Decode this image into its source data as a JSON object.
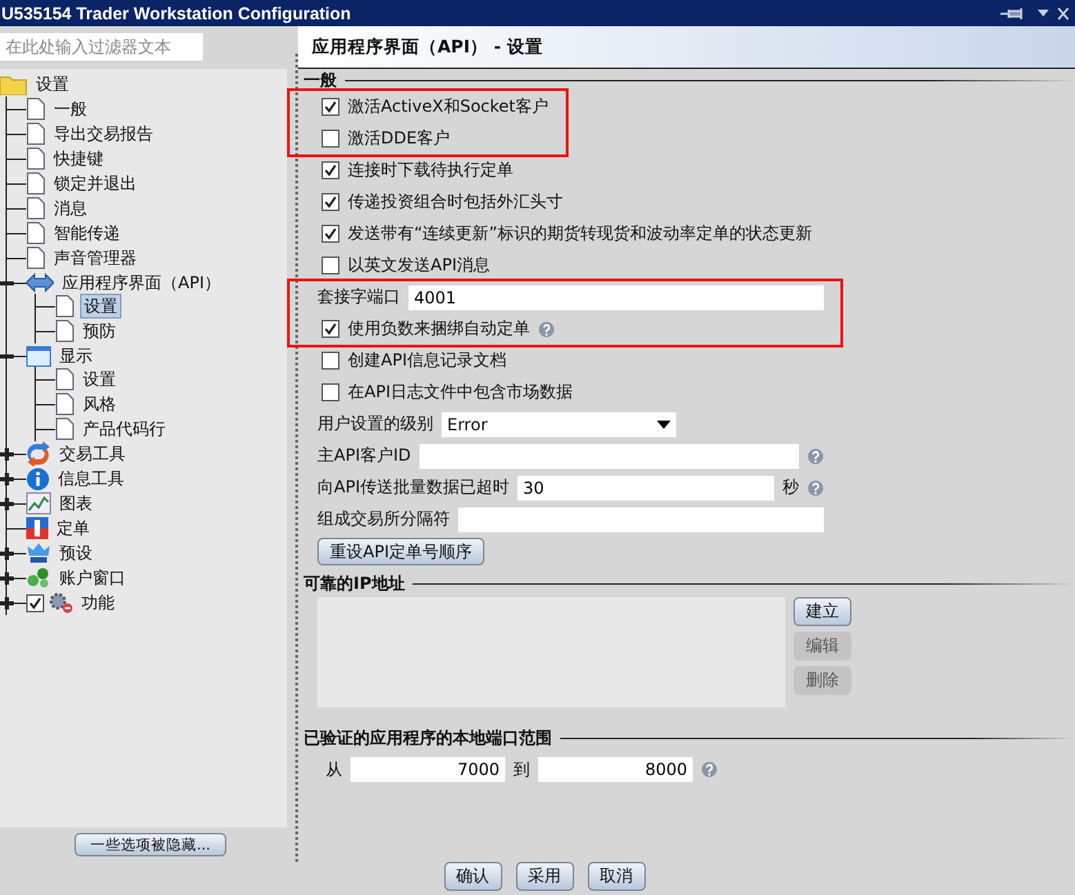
{
  "window": {
    "title": "U535154 Trader Workstation Configuration"
  },
  "filter": {
    "placeholder": "在此处输入过滤器文本"
  },
  "tree": [
    {
      "label": "设置",
      "kind": "folder",
      "selected": false,
      "children": [
        {
          "label": "一般",
          "kind": "page",
          "selected": false
        },
        {
          "label": "导出交易报告",
          "kind": "page",
          "selected": false
        },
        {
          "label": "快捷键",
          "kind": "page",
          "selected": false
        },
        {
          "label": "锁定并退出",
          "kind": "page",
          "selected": false
        },
        {
          "label": "消息",
          "kind": "page",
          "selected": false
        },
        {
          "label": "智能传递",
          "kind": "page",
          "selected": false
        },
        {
          "label": "声音管理器",
          "kind": "page",
          "selected": false
        },
        {
          "label": "应用程序界面（API）",
          "kind": "arrows",
          "expanded": true,
          "selected": false,
          "children": [
            {
              "label": "设置",
              "kind": "page",
              "selected": true
            },
            {
              "label": "预防",
              "kind": "page",
              "selected": false
            }
          ]
        },
        {
          "label": "显示",
          "kind": "display",
          "expanded": true,
          "selected": false,
          "children": [
            {
              "label": "设置",
              "kind": "page",
              "selected": false
            },
            {
              "label": "风格",
              "kind": "page",
              "selected": false
            },
            {
              "label": "产品代码行",
              "kind": "page",
              "selected": false
            }
          ]
        },
        {
          "label": "交易工具",
          "kind": "tools",
          "expanded": false,
          "selected": false
        },
        {
          "label": "信息工具",
          "kind": "info",
          "expanded": false,
          "selected": false
        },
        {
          "label": "图表",
          "kind": "chart",
          "expanded": false,
          "selected": false
        },
        {
          "label": "定单",
          "kind": "order",
          "selected": false
        },
        {
          "label": "预设",
          "kind": "crown",
          "expanded": false,
          "selected": false
        },
        {
          "label": "账户窗口",
          "kind": "account",
          "expanded": false,
          "selected": false
        },
        {
          "label": "功能",
          "kind": "gears",
          "expanded": false,
          "selected": false,
          "checked": true
        }
      ]
    }
  ],
  "hidden_button": "一些选项被隐藏...",
  "panel": {
    "title": "应用程序界面（API） - 设置",
    "general": {
      "title": "一般",
      "groups": [
        {
          "highlighted": true,
          "rows": [
            {
              "kind": "checkbox",
              "label": "激活ActiveX和Socket客户",
              "checked": true
            },
            {
              "kind": "checkbox",
              "label": "激活DDE客户",
              "checked": false
            }
          ]
        },
        {
          "rows": [
            {
              "kind": "checkbox",
              "label": "连接时下载待执行定单",
              "checked": true
            },
            {
              "kind": "checkbox",
              "label": "传递投资组合时包括外汇头寸",
              "checked": true
            },
            {
              "kind": "checkbox",
              "label": "发送带有“连续更新”标识的期货转现货和波动率定单的状态更新",
              "checked": true
            },
            {
              "kind": "checkbox",
              "label": "以英文发送API消息",
              "checked": false
            }
          ]
        },
        {
          "highlighted": true,
          "rows": [
            {
              "kind": "field",
              "label": "套接字端口",
              "value": "4001"
            },
            {
              "kind": "checkbox",
              "label": "使用负数来捆绑自动定单",
              "checked": true,
              "help": true
            }
          ]
        },
        {
          "rows": [
            {
              "kind": "checkbox",
              "label": "创建API信息记录文档",
              "checked": false
            },
            {
              "kind": "checkbox",
              "label": "在API日志文件中包含市场数据",
              "checked": false
            },
            {
              "kind": "select",
              "label": "用户设置的级别",
              "value": "Error"
            },
            {
              "kind": "field",
              "label": "主API客户ID",
              "value": "",
              "help": true
            },
            {
              "kind": "field",
              "label": "向API传送批量数据已超时",
              "value": "30",
              "unit": "秒",
              "help": true
            },
            {
              "kind": "field",
              "label": "组成交易所分隔符",
              "value": ""
            },
            {
              "kind": "button",
              "label": "重设API定单号顺序"
            }
          ]
        }
      ]
    },
    "trusted_ips": {
      "title": "可靠的IP地址",
      "buttons": [
        {
          "label": "建立",
          "disabled": false
        },
        {
          "label": "编辑",
          "disabled": true
        },
        {
          "label": "删除",
          "disabled": true
        }
      ]
    },
    "port_range": {
      "title": "已验证的应用程序的本地端口范围",
      "from_label": "从",
      "from": "7000",
      "to_label": "到",
      "to": "8000"
    }
  },
  "buttons": [
    "确认",
    "采用",
    "取消"
  ]
}
